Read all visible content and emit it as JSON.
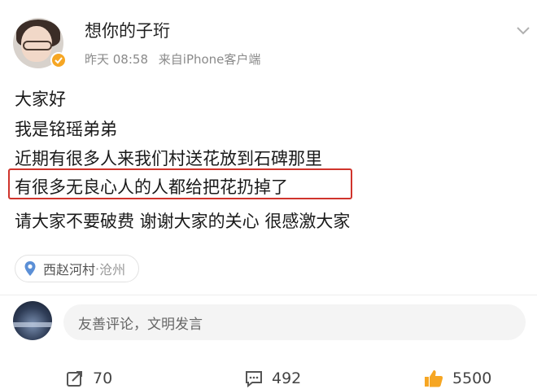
{
  "post": {
    "author": "想你的子珩",
    "time": "昨天 08:58",
    "source": "来自iPhone客户端",
    "lines": [
      "大家好",
      "我是铭瑶弟弟",
      "近期有很多人来我们村送花放到石碑那里",
      "有很多无良心人的人都给把花扔掉了",
      "请大家不要破费 谢谢大家的关心 很感激大家"
    ],
    "highlighted_line_index": 3,
    "location": {
      "place": "西赵河村",
      "separator": "·",
      "city": "沧州"
    }
  },
  "comment_box": {
    "placeholder": "友善评论，文明发言"
  },
  "actions": {
    "repost_count": "70",
    "comment_count": "492",
    "like_count": "5500"
  },
  "colors": {
    "highlight_border": "#d0342c",
    "location_pin": "#5b8fd6",
    "like_accent": "#f6a623",
    "verified_badge": "#f6a623"
  },
  "icons": [
    "verified-badge-icon",
    "chevron-down-icon",
    "location-pin-icon",
    "repost-icon",
    "comment-icon",
    "like-icon"
  ]
}
